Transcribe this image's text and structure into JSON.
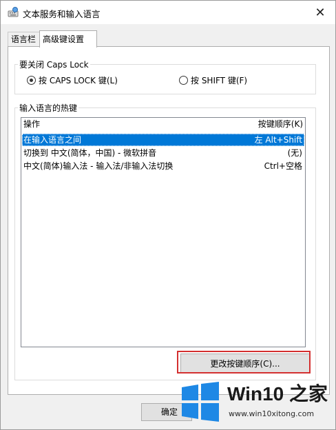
{
  "window": {
    "title": "文本服务和输入语言",
    "icon": "keyboard-globe-icon",
    "close_glyph": "✕"
  },
  "tabs": [
    {
      "label": "语言栏"
    },
    {
      "label": "高级键设置",
      "active": true
    }
  ],
  "caps_lock": {
    "legend": "要关闭 Caps Lock",
    "options": [
      {
        "label": "按 CAPS LOCK 键(L)",
        "checked": true
      },
      {
        "label": "按 SHIFT 键(F)",
        "checked": false
      }
    ]
  },
  "hotkeys": {
    "legend": "输入语言的热键",
    "columns": {
      "operation": "操作",
      "key_sequence": "按键顺序(K)"
    },
    "rows": [
      {
        "operation": "在输入语言之间",
        "keys": "左 Alt+Shift",
        "selected": true
      },
      {
        "operation": "切换到 中文(简体，中国) - 微软拼音",
        "keys": "(无)"
      },
      {
        "operation": "中文(简体)输入法 - 输入法/非输入法切换",
        "keys": "Ctrl+空格"
      }
    ],
    "change_button": "更改按键顺序(C)..."
  },
  "footer": {
    "ok_label": "确定"
  },
  "watermark": {
    "title": "Win10 之家",
    "url": "www.win10xitong.com",
    "colors": {
      "logo": "#1e88e5"
    }
  },
  "colors": {
    "selection": "#0078d7",
    "highlight_box": "#d32f2f"
  }
}
